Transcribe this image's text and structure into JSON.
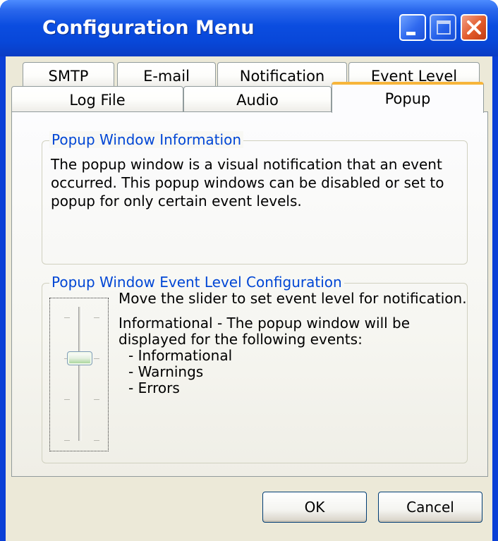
{
  "window": {
    "title": "Configuration Menu"
  },
  "title_buttons": {
    "minimize": "minimize-icon",
    "maximize": "maximize-icon",
    "close": "close-icon"
  },
  "tabs": {
    "row1": [
      "SMTP",
      "E-mail",
      "Notification",
      "Event Level"
    ],
    "row2": [
      "Log File",
      "Audio",
      "Popup"
    ],
    "active": "Popup"
  },
  "info_group": {
    "legend": "Popup Window Information",
    "text": "The popup window is a visual notification that an event occurred. This popup windows can be disabled or set to popup for only certain event levels."
  },
  "level_group": {
    "legend": "Popup Window Event Level Configuration",
    "instruction": "Move the slider to set event level for notification.",
    "level_text_1": "Informational - The popup window will be",
    "level_text_2": "displayed for the following events:",
    "events": [
      "- Informational",
      "- Warnings",
      "- Errors"
    ],
    "slider_level_index": 1,
    "slider_levels": 4
  },
  "buttons": {
    "ok": "OK",
    "cancel": "Cancel"
  },
  "colors": {
    "title_bar": "#0a4de0",
    "legend_text": "#0046d5",
    "active_tab_accent": "#f7b53b",
    "dialog_bg": "#ece9d8"
  }
}
